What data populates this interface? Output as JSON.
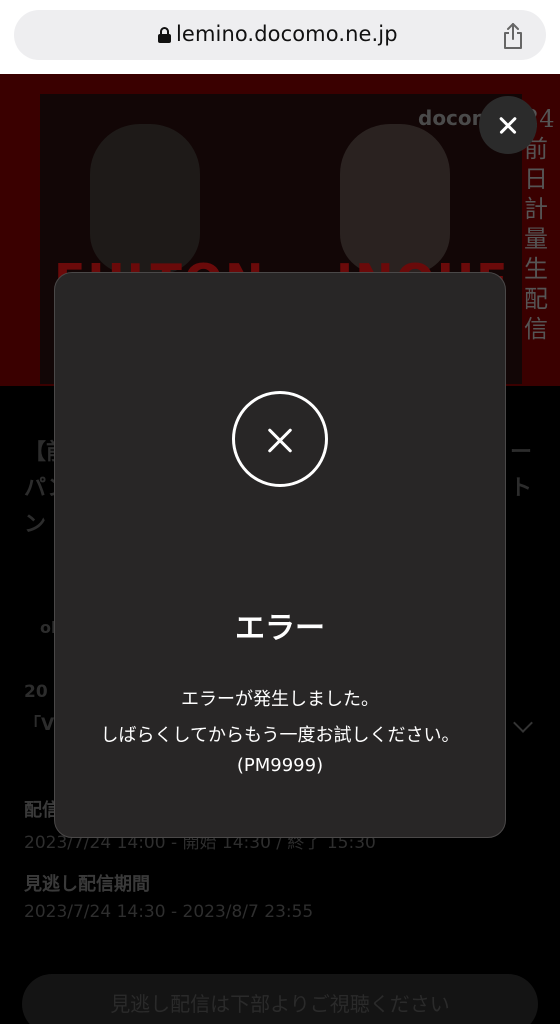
{
  "browser": {
    "url": "lemino.docomo.ne.jp",
    "lock_icon": "lock-icon",
    "share_icon": "share-icon"
  },
  "hero": {
    "brand": "docomo",
    "vertical_text": "24前日計量生配信",
    "fighter_left": "FULTON",
    "fighter_right": "INOUE"
  },
  "background": {
    "title_fragments": [
      "【前",
      "パン",
      "ン",
      "ー",
      "ト"
    ],
    "small_fragment": "ol",
    "date_fragment": "20",
    "sub_fragment": "「V",
    "live_label": "配信",
    "live_value": "2023/7/24 14:00 - 開始 14:30 / 終了 15:30",
    "replay_label": "見逃し配信期間",
    "replay_value": "2023/7/24 14:30  -  2023/8/7 23:55",
    "bottom_button": "見逃し配信は下部よりご視聴ください"
  },
  "modal": {
    "title": "エラー",
    "message_line1": "エラーが発生しました。",
    "message_line2": "しばらくしてからもう一度お試しください。",
    "code": "(PM9999)"
  },
  "colors": {
    "modal_bg": "#282626",
    "hero_bg": "#3a0000",
    "accent": "#ffffff"
  }
}
